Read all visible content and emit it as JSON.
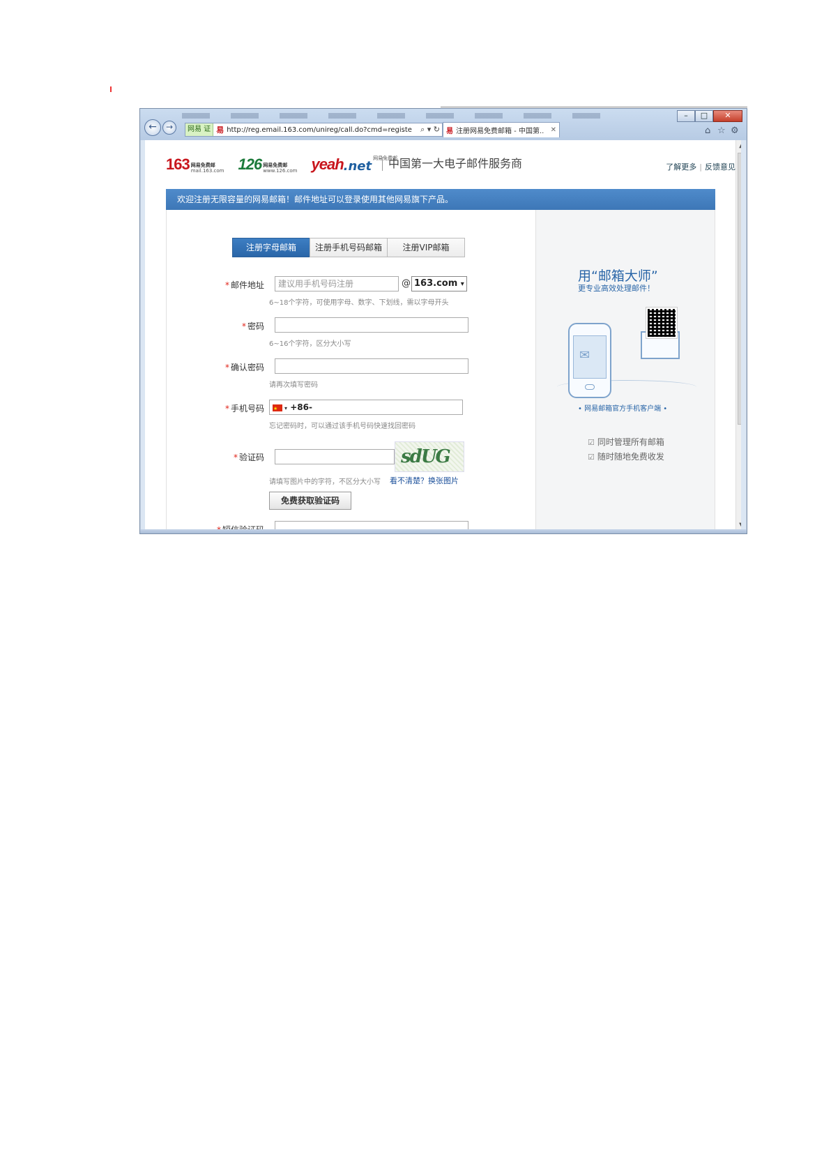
{
  "browser": {
    "address_badge": "网易 证",
    "url": "http://reg.email.163.com/unireg/call.do?cmd=registe",
    "tab_title": "注册网易免费邮箱 - 中国第..",
    "address_tools": "⌕ ▾ ↻"
  },
  "header": {
    "logo163": {
      "num": "163",
      "sub_top": "网易免费邮",
      "sub_bottom": "mail.163.com"
    },
    "logo126": {
      "num": "126",
      "sub_top": "网易免费邮",
      "sub_bottom": "www.126.com"
    },
    "logoyeah": {
      "yeah": "yeah",
      "net": ".net",
      "sup": "网易免费邮"
    },
    "slogan": "中国第一大电子邮件服务商",
    "link_more": "了解更多",
    "link_feedback": "反馈意见"
  },
  "banner": "欢迎注册无限容量的网易邮箱！邮件地址可以登录使用其他网易旗下产品。",
  "tabs": [
    "注册字母邮箱",
    "注册手机号码邮箱",
    "注册VIP邮箱"
  ],
  "form": {
    "email_label": "邮件地址",
    "email_placeholder": "建议用手机号码注册",
    "at": "@",
    "domain": "163.com",
    "email_hint": "6~18个字符，可使用字母、数字、下划线，需以字母开头",
    "password_label": "密码",
    "password_hint": "6~16个字符，区分大小写",
    "confirm_label": "确认密码",
    "confirm_hint": "请再次填写密码",
    "phone_label": "手机号码",
    "phone_prefix": "+86-",
    "phone_hint": "忘记密码时，可以通过该手机号码快速找回密码",
    "captcha_label": "验证码",
    "captcha_text": "sdUG",
    "captcha_hint": "请填写图片中的字符，不区分大小写",
    "captcha_refresh": "看不清楚？换张图片",
    "sms_button": "免费获取验证码",
    "sms_label": "短信验证码",
    "required_mark": "*"
  },
  "side": {
    "title": "用“邮箱大师”",
    "subtitle": "更专业高效处理邮件！",
    "caption": "• 网易邮箱官方手机客户端 •",
    "features": [
      "同时管理所有邮箱",
      "随时随地免费收发"
    ]
  }
}
